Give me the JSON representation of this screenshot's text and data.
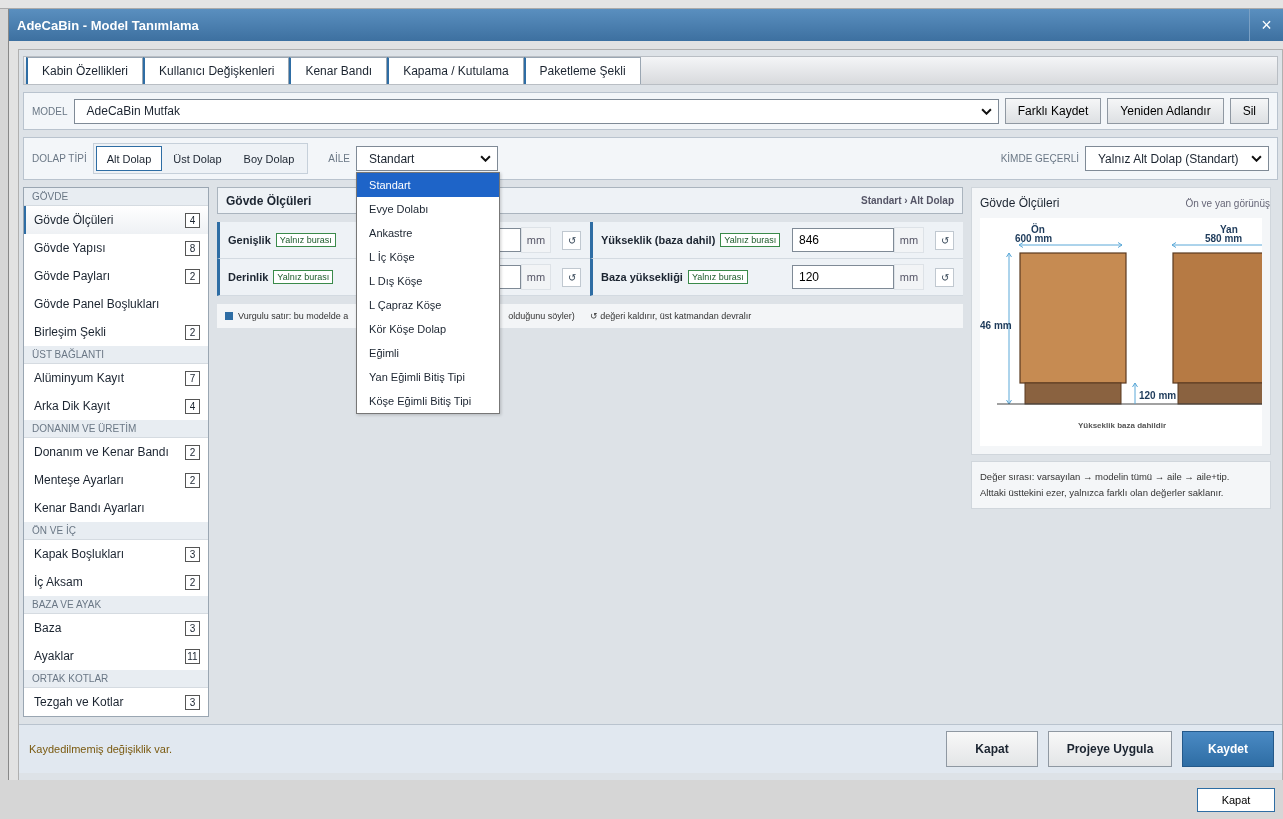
{
  "window": {
    "title": "AdeCaBin - Model Tanımlama",
    "close": "×"
  },
  "tabs": [
    {
      "label": "Kabin Özellikleri",
      "selected": false
    },
    {
      "label": "Kullanıcı Değişkenleri",
      "selected": false
    },
    {
      "label": "Kenar Bandı",
      "selected": false
    },
    {
      "label": "Kapama / Kutulama",
      "selected": false
    },
    {
      "label": "Paketleme Şekli",
      "selected": false
    }
  ],
  "model": {
    "label": "MODEL",
    "value": "AdeCaBin Mutfak",
    "buttons": [
      "Farklı Kaydet",
      "Yeniden Adlandır",
      "Sil"
    ]
  },
  "dolap_tipi": {
    "label": "DOLAP TİPİ",
    "options": [
      {
        "label": "Alt Dolap",
        "selected": true
      },
      {
        "label": "Üst Dolap",
        "selected": false
      },
      {
        "label": "Boy Dolap",
        "selected": false
      }
    ]
  },
  "aile": {
    "label": "AİLE",
    "value": "Standart",
    "options": [
      {
        "label": "Standart",
        "selected": true
      },
      {
        "label": "Evye Dolabı",
        "selected": false
      },
      {
        "label": "Ankastre",
        "selected": false
      },
      {
        "label": "L İç Köşe",
        "selected": false
      },
      {
        "label": "L Dış Köşe",
        "selected": false
      },
      {
        "label": "L Çapraz Köşe",
        "selected": false
      },
      {
        "label": "Kör Köşe Dolap",
        "selected": false
      },
      {
        "label": "Eğimli",
        "selected": false
      },
      {
        "label": "Yan Eğimli Bitiş Tipi",
        "selected": false
      },
      {
        "label": "Köşe Eğimli Bitiş Tipi",
        "selected": false
      }
    ]
  },
  "kimde": {
    "label": "KİMDE GEÇERLİ",
    "value": "Yalnız Alt Dolap (Standart)"
  },
  "sidebar": [
    {
      "title": "GÖVDE",
      "items": [
        {
          "label": "Gövde Ölçüleri",
          "count": "4",
          "selected": true
        },
        {
          "label": "Gövde Yapısı",
          "count": "8",
          "selected": false
        },
        {
          "label": "Gövde Payları",
          "count": "2",
          "selected": false
        },
        {
          "label": "Gövde Panel Boşlukları",
          "selected": false
        },
        {
          "label": "Birleşim Şekli",
          "count": "2",
          "selected": false
        }
      ]
    },
    {
      "title": "ÜST BAĞLANTI",
      "items": [
        {
          "label": "Alüminyum Kayıt",
          "count": "7",
          "selected": false
        },
        {
          "label": "Arka Dik Kayıt",
          "count": "4",
          "selected": false
        }
      ]
    },
    {
      "title": "DONANIM VE ÜRETİM",
      "items": [
        {
          "label": "Donanım ve Kenar Bandı",
          "count": "2",
          "selected": false
        },
        {
          "label": "Menteşe Ayarları",
          "count": "2",
          "selected": false
        },
        {
          "label": "Kenar Bandı Ayarları",
          "selected": false
        }
      ]
    },
    {
      "title": "ÖN VE İÇ",
      "items": [
        {
          "label": "Kapak Boşlukları",
          "count": "3",
          "selected": false
        },
        {
          "label": "İç Aksam",
          "count": "2",
          "selected": false
        }
      ]
    },
    {
      "title": "BAZA VE AYAK",
      "items": [
        {
          "label": "Baza",
          "count": "3",
          "selected": false
        },
        {
          "label": "Ayaklar",
          "count": "11",
          "selected": false
        }
      ]
    },
    {
      "title": "ORTAK KOTLAR",
      "items": [
        {
          "label": "Tezgah ve Kotlar",
          "count": "3",
          "selected": false
        }
      ]
    }
  ],
  "section": {
    "title": "Gövde Ölçüleri",
    "breadcrumb": "Standart › Alt Dolap"
  },
  "fields": [
    {
      "label": "Genişlik",
      "badge": "Yalnız burası",
      "unit": "mm",
      "reset": "↺"
    },
    {
      "label": "Yükseklik (baza dahil)",
      "badge": "Yalnız burası",
      "value": "846",
      "unit": "mm",
      "reset": "↺"
    },
    {
      "label": "Derinlik",
      "badge": "Yalnız burası",
      "unit": "mm",
      "reset": "↺"
    },
    {
      "label": "Baza yüksekliği",
      "badge": "Yalnız burası",
      "value": "120",
      "unit": "mm",
      "reset": "↺"
    }
  ],
  "legend": {
    "highlight_start": "Vurgulu satır: bu modelde a",
    "highlight_end": "olduğunu söyler)",
    "reset_note": "↺ değeri kaldırır, üst katmandan devralır"
  },
  "preview": {
    "title": "Gövde Ölçüleri",
    "subtitle": "Ön ve yan görünüş",
    "front_label": "Ön",
    "side_label": "Yan",
    "width": "600 mm",
    "depth": "580 mm",
    "height": "46 mm",
    "base": "120 mm",
    "caption": "Yükseklik baza dahildir"
  },
  "note": [
    "Değer sırası: varsayılan → modelin tümü → aile → aile+tip.",
    "Alttaki üsttekini ezer, yalnızca farklı olan değerler saklanır."
  ],
  "footer": {
    "status": "Kaydedilmemiş değişiklik var.",
    "buttons": [
      {
        "label": "Kapat",
        "kind": "default"
      },
      {
        "label": "Projeye Uygula",
        "kind": "default"
      },
      {
        "label": "Kaydet",
        "kind": "primary"
      }
    ]
  },
  "outer_button": "Kapat"
}
